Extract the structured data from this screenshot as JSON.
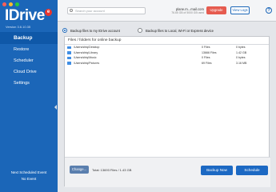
{
  "app": {
    "logo_text": "IDrive",
    "logo_badge": "e",
    "version": "Version 3.6.10.35"
  },
  "sidebar": {
    "items": [
      {
        "label": "Backup"
      },
      {
        "label": "Restore"
      },
      {
        "label": "Scheduler"
      },
      {
        "label": "Cloud Drive"
      },
      {
        "label": "Settings"
      }
    ],
    "next_scheduled_label": "Next Scheduled Event",
    "next_scheduled_value": "No Event"
  },
  "topbar": {
    "search_placeholder": "Search your account",
    "account_email": "plane.m...mail.com",
    "account_usage": "76.65 GB of 5000 GB used",
    "upgrade_label": "Upgrade",
    "view_logs_label": "View Logs",
    "help_label": "?"
  },
  "main": {
    "option_idrive": "Backup files to my IDrive account",
    "option_local": "Backup files to Local, Wi-Fi or Express device",
    "panel_title": "Files / folders for online backup",
    "rows": [
      {
        "path": "/Users/shtq/Desktop",
        "files": "0 Files",
        "size": "0 bytes"
      },
      {
        "path": "/Users/shtq/Library",
        "files": "13666 Files",
        "size": "1.42 GB"
      },
      {
        "path": "/Users/shtq/Music",
        "files": "0 Files",
        "size": "0 bytes"
      },
      {
        "path": "/Users/shtq/Pictures",
        "files": "69 Files",
        "size": "3.16 MB"
      }
    ],
    "change_label": "Change...",
    "total_text": "Total: 13693 Files / 1.43 GB",
    "backup_now_label": "Backup Now",
    "schedule_label": "Schedule"
  },
  "colors": {
    "sidebar": "#1b66b8",
    "primary_button": "#1c69c3",
    "upgrade_button": "#e65b4f",
    "folder": "#3f8ee5"
  }
}
